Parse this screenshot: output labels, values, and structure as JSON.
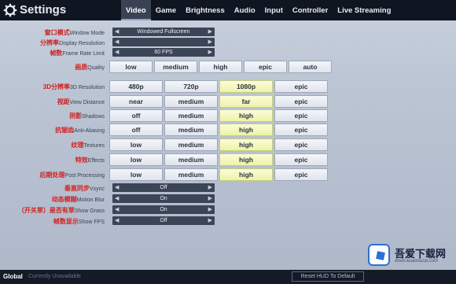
{
  "header": {
    "title": "Settings",
    "tabs": [
      {
        "label": "Video",
        "active": true
      },
      {
        "label": "Game"
      },
      {
        "label": "Brightness"
      },
      {
        "label": "Audio"
      },
      {
        "label": "Input"
      },
      {
        "label": "Controller"
      },
      {
        "label": "Live Streaming"
      }
    ]
  },
  "settings": {
    "window_mode": {
      "label_zh": "窗口模式",
      "label": "Window Mode",
      "value": "Windowed Fullscreen"
    },
    "display_resolution": {
      "label_zh": "分辨率",
      "label": "Display Resolution",
      "value": ""
    },
    "frame_rate": {
      "label_zh": "帧数",
      "label": "Frame Rate Limit",
      "value": "60 FPS"
    },
    "quality": {
      "label_zh": "画质",
      "label": "Quality",
      "options": [
        "low",
        "medium",
        "high",
        "epic",
        "auto"
      ]
    },
    "3d_resolution": {
      "label_zh": "3D分辨率",
      "label": "3D Resolution",
      "options": [
        "480p",
        "720p",
        "1080p",
        "epic"
      ],
      "selected": 2
    },
    "view_distance": {
      "label_zh": "视距",
      "label": "View Distance",
      "options": [
        "near",
        "medium",
        "far",
        "epic"
      ],
      "selected": 2
    },
    "shadows": {
      "label_zh": "阴影",
      "label": "Shadows",
      "options": [
        "off",
        "medium",
        "high",
        "epic"
      ],
      "selected": 2
    },
    "anti_aliasing": {
      "label_zh": "抗锯齿",
      "label": "Anti-Aliasing",
      "options": [
        "off",
        "medium",
        "high",
        "epic"
      ],
      "selected": 2
    },
    "textures": {
      "label_zh": "纹理",
      "label": "Textures",
      "options": [
        "low",
        "medium",
        "high",
        "epic"
      ],
      "selected": 2
    },
    "effects": {
      "label_zh": "特效",
      "label": "Effects",
      "options": [
        "low",
        "medium",
        "high",
        "epic"
      ],
      "selected": 2
    },
    "post_processing": {
      "label_zh": "后期处理",
      "label": "Post Processing",
      "options": [
        "low",
        "medium",
        "high",
        "epic"
      ],
      "selected": 2
    },
    "vsync": {
      "label_zh": "垂直同步",
      "label": "Vsync",
      "value": "Off"
    },
    "motion_blur": {
      "label_zh": "动态模糊",
      "label": "Motion Blur",
      "value": "On"
    },
    "show_grass": {
      "label_zh": "（开关草）是否有草",
      "label": "Show Grass",
      "value": "On"
    },
    "show_fps": {
      "label_zh": "帧数显示",
      "label": "Show FPS",
      "value": "Off"
    }
  },
  "footer": {
    "scope": "Global",
    "hint": "Currently Unavailable",
    "reset_label": "Reset HUD To Default"
  },
  "watermark": {
    "name": "吾爱下载网",
    "url": "www.wuaixiazai.com"
  },
  "colors": {
    "topbar": "#101621",
    "selected_option": "#eef3a4",
    "label_zh": "#d02020"
  }
}
